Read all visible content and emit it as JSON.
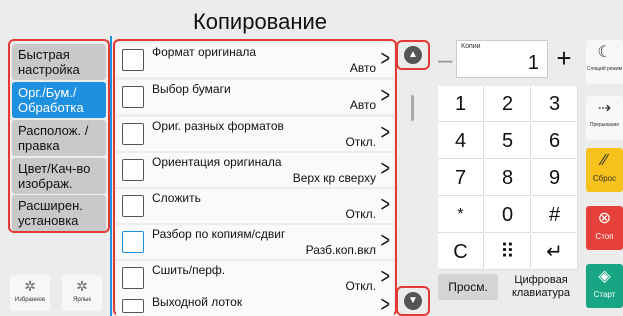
{
  "title": "Копирование",
  "tabs": [
    {
      "label": "Быстрая настройка",
      "active": false
    },
    {
      "label": "Орг./Бум./ Обработка",
      "active": true
    },
    {
      "label": "Располож. /правка",
      "active": false
    },
    {
      "label": "Цвет/Кач-во изображ.",
      "active": false
    },
    {
      "label": "Расширен. установка",
      "active": false
    }
  ],
  "bottom_left": {
    "favorites_label": "Избранное",
    "shortcut_label": "Ярлык"
  },
  "functions": [
    {
      "label": "Формат оригинала",
      "value": "Авто",
      "icon": "original-size-icon"
    },
    {
      "label": "Выбор бумаги",
      "value": "Авто",
      "icon": "paper-selection-icon"
    },
    {
      "label": "Ориг. разных форматов",
      "value": "Откл.",
      "icon": "mixed-originals-icon"
    },
    {
      "label": "Ориентация оригинала",
      "value": "Верх кр сверху",
      "icon": "orientation-icon"
    },
    {
      "label": "Сложить",
      "value": "Откл.",
      "icon": "fold-icon"
    },
    {
      "label": "Разбор по копиям/сдвиг",
      "value": "Разб.коп.вкл",
      "icon": "collate-icon"
    },
    {
      "label": "Сшить/перф.",
      "value": "Откл.",
      "icon": "staple-icon"
    },
    {
      "label": "Выходной лоток",
      "value": "",
      "icon": "output-tray-icon"
    }
  ],
  "copies": {
    "label": "Копии",
    "value": "1",
    "minus": "–",
    "plus": "+"
  },
  "keypad": [
    "1",
    "2",
    "3",
    "4",
    "5",
    "6",
    "7",
    "8",
    "9",
    "*",
    "0",
    "#",
    "C",
    "⠿",
    "↵"
  ],
  "preview_label": "Просм.",
  "numpad_label": "Цифровая клавиатура",
  "right": {
    "sleep_label": "Спящий режим",
    "interrupt_label": "Прерывание",
    "reset_label": "Сброс",
    "stop_label": "Стоп",
    "start_label": "Старт"
  },
  "colors": {
    "accent": "#1f8fe0",
    "highlight": "#e53935",
    "reset": "#f6c21b",
    "stop": "#e5413a",
    "start": "#19a583"
  }
}
